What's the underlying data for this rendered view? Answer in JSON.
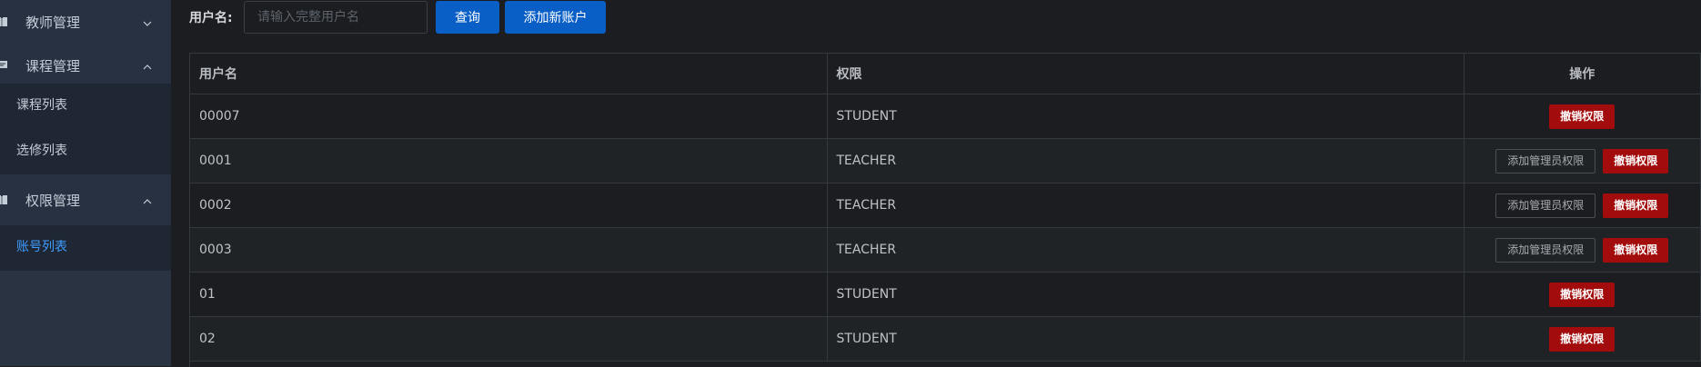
{
  "sidebar": {
    "groups": [
      {
        "label": "教师管理",
        "icon": "book-icon",
        "expanded": false
      },
      {
        "label": "课程管理",
        "icon": "chat-icon",
        "expanded": true,
        "items": [
          "课程列表",
          "选修列表"
        ]
      },
      {
        "label": "权限管理",
        "icon": "book-icon",
        "expanded": true,
        "items": [
          "账号列表"
        ]
      }
    ],
    "active_item": "账号列表"
  },
  "search": {
    "label": "用户名:",
    "placeholder": "请输入完整用户名",
    "value": ""
  },
  "toolbar": {
    "query_label": "查询",
    "add_label": "添加新账户"
  },
  "table": {
    "headers": [
      "用户名",
      "权限",
      "操作"
    ],
    "rows": [
      {
        "username": "00007",
        "role": "STUDENT",
        "actions": [
          "撤销权限"
        ]
      },
      {
        "username": "0001",
        "role": "TEACHER",
        "actions": [
          "添加管理员权限",
          "撤销权限"
        ]
      },
      {
        "username": "0002",
        "role": "TEACHER",
        "actions": [
          "添加管理员权限",
          "撤销权限"
        ]
      },
      {
        "username": "0003",
        "role": "TEACHER",
        "actions": [
          "添加管理员权限",
          "撤销权限"
        ]
      },
      {
        "username": "01",
        "role": "STUDENT",
        "actions": [
          "撤销权限"
        ]
      },
      {
        "username": "02",
        "role": "STUDENT",
        "actions": [
          "撤销权限"
        ]
      }
    ]
  },
  "colors": {
    "primary": "#0a5fc7",
    "danger": "#a30c0c",
    "active_link": "#3f9cff",
    "sidebar_bg": "#2a3342",
    "page_bg": "#1b1d20"
  }
}
